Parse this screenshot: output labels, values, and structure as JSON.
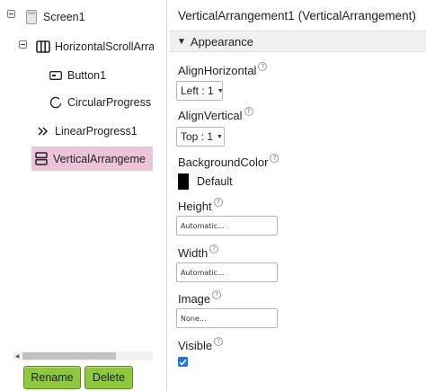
{
  "tree": {
    "nodes": [
      {
        "label": "Screen1",
        "icon": "screen-icon"
      },
      {
        "label": "HorizontalScrollArra",
        "icon": "horizontal-arrangement-icon"
      },
      {
        "label": "Button1",
        "icon": "button-icon"
      },
      {
        "label": "CircularProgress",
        "icon": "circular-progress-icon"
      },
      {
        "label": "LinearProgress1",
        "icon": "linear-progress-icon"
      },
      {
        "label": "VerticalArrangeme",
        "icon": "vertical-arrangement-icon",
        "selected": true
      }
    ],
    "rename_label": "Rename",
    "delete_label": "Delete"
  },
  "properties": {
    "header": "VerticalArrangement1 (VerticalArrangement)",
    "section": "Appearance",
    "align_horizontal": {
      "label": "AlignHorizontal",
      "value": "Left : 1"
    },
    "align_vertical": {
      "label": "AlignVertical",
      "value": "Top : 1"
    },
    "background_color": {
      "label": "BackgroundColor",
      "value": "Default",
      "swatch": "#000000"
    },
    "height": {
      "label": "Height",
      "value": "Automatic..."
    },
    "width": {
      "label": "Width",
      "value": "Automatic..."
    },
    "image": {
      "label": "Image",
      "value": "None..."
    },
    "visible": {
      "label": "Visible",
      "checked": true
    }
  },
  "colors": {
    "selection": "#ecc3d9",
    "button_green": "#8fc73e",
    "checkbox_blue": "#1a73e8"
  }
}
